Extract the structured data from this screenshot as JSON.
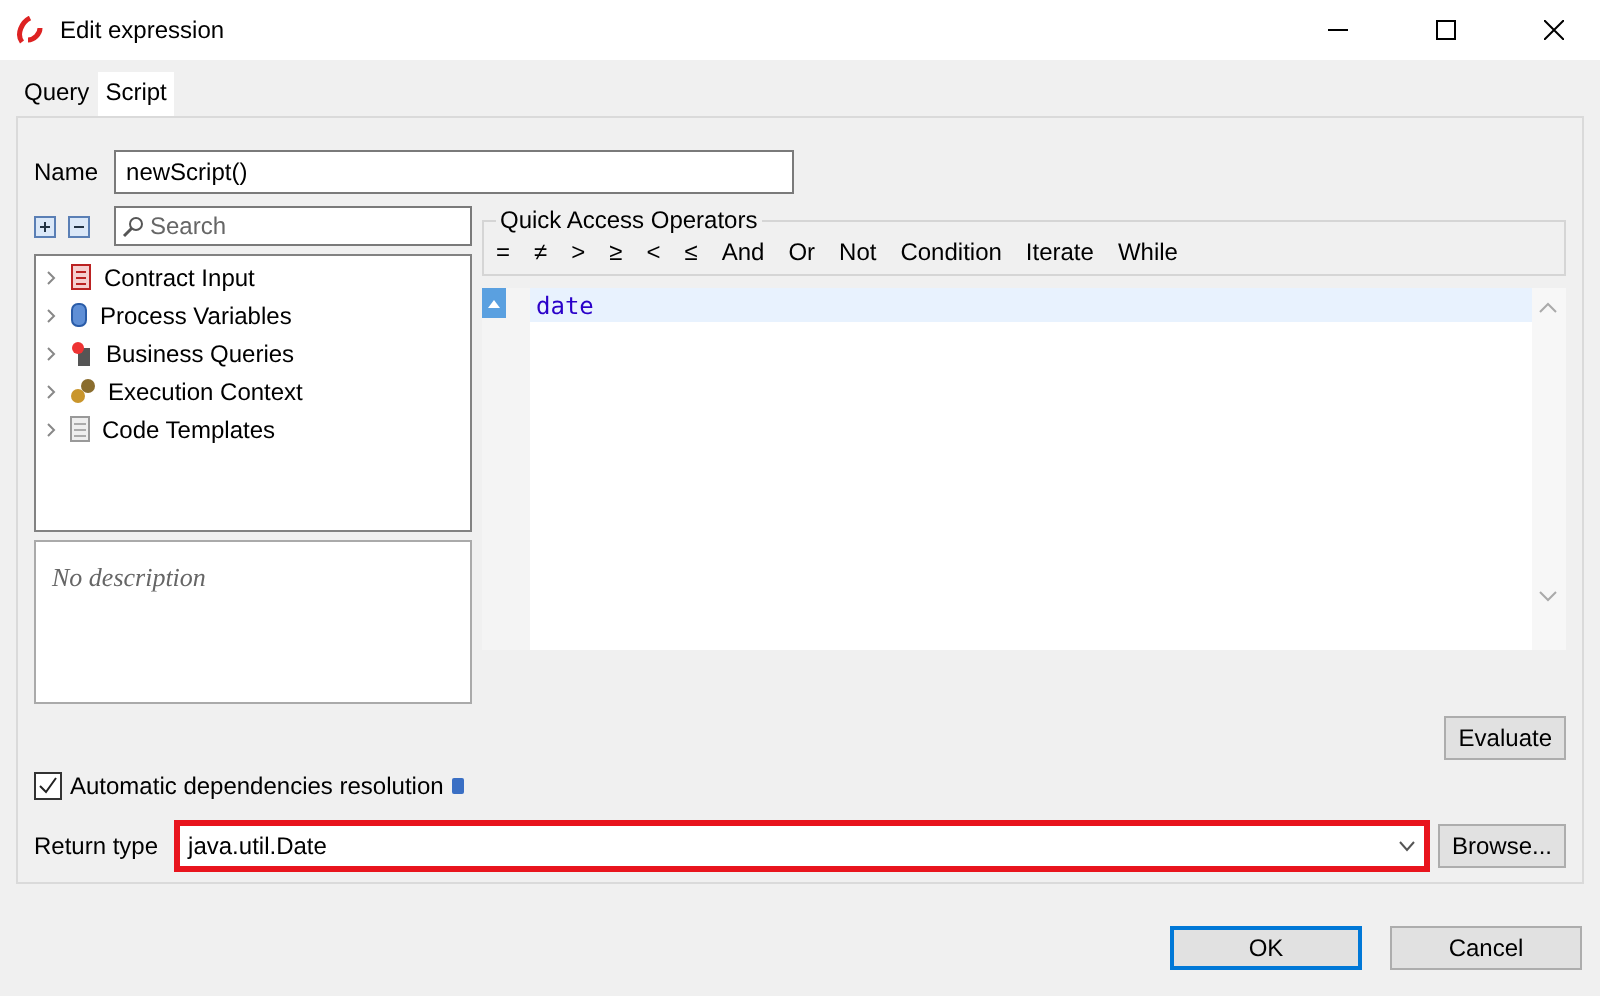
{
  "window": {
    "title": "Edit expression"
  },
  "tabs": [
    {
      "label": "Query",
      "selected": false
    },
    {
      "label": "Script",
      "selected": true
    }
  ],
  "name_field": {
    "label": "Name",
    "value": "newScript()"
  },
  "search": {
    "placeholder": "Search"
  },
  "tree": [
    {
      "label": "Contract Input",
      "kind": "contract"
    },
    {
      "label": "Process Variables",
      "kind": "variables"
    },
    {
      "label": "Business Queries",
      "kind": "queries"
    },
    {
      "label": "Execution Context",
      "kind": "context"
    },
    {
      "label": "Code Templates",
      "kind": "templates"
    }
  ],
  "description": "No description",
  "operators": {
    "title": "Quick Access Operators",
    "items": [
      "=",
      "≠",
      ">",
      "≥",
      "<",
      "≤",
      "And",
      "Or",
      "Not",
      "Condition",
      "Iterate",
      "While"
    ]
  },
  "editor": {
    "lines": [
      "date"
    ]
  },
  "evaluate": "Evaluate",
  "auto_dependencies": {
    "label": "Automatic dependencies resolution",
    "checked": true
  },
  "return_type": {
    "label": "Return type",
    "value": "java.util.Date",
    "browse": "Browse..."
  },
  "buttons": [
    {
      "label": "OK",
      "default": true
    },
    {
      "label": "Cancel",
      "default": false
    }
  ]
}
